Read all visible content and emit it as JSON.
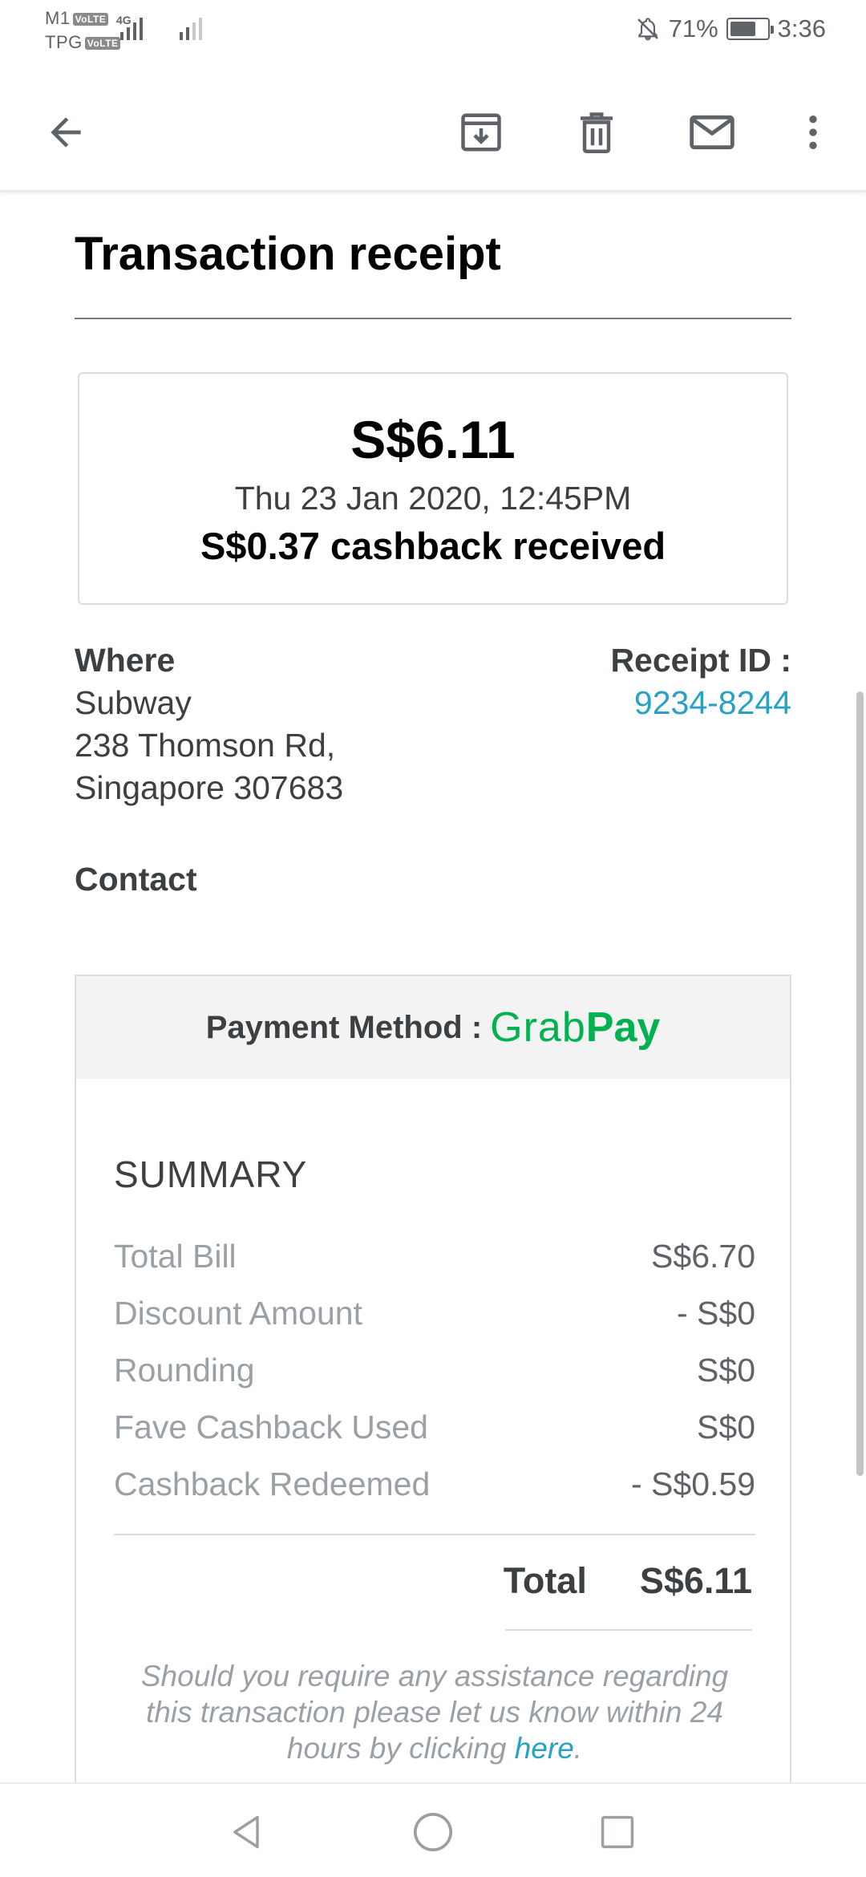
{
  "status_bar": {
    "carrier1": "M1",
    "carrier2": "TPG",
    "volte": "VoLTE",
    "network": "4G",
    "battery": "71%",
    "battery_level": 0.71,
    "time": "3:36",
    "icons": [
      "do-not-disturb-icon",
      "signal-icon",
      "battery-icon"
    ]
  },
  "toolbar": {
    "icons": [
      "back-arrow-icon",
      "archive-icon",
      "delete-icon",
      "mail-icon",
      "more-vert-icon"
    ]
  },
  "receipt": {
    "title": "Transaction receipt",
    "amount": "S$6.11",
    "date": "Thu 23 Jan 2020, 12:45PM",
    "cashback": "S$0.37 cashback received",
    "where_label": "Where",
    "merchant": "Subway",
    "address_line1": "238 Thomson Rd,",
    "address_line2": "Singapore 307683",
    "receipt_id_label": "Receipt ID :",
    "receipt_id": "9234-8244",
    "contact_label": "Contact"
  },
  "payment": {
    "label": "Payment Method :",
    "logo_part1": "Grab",
    "logo_part2": "Pay",
    "brand_color": "#00b14f"
  },
  "summary": {
    "title": "SUMMARY",
    "rows": [
      {
        "label": "Total Bill",
        "value": "S$6.70"
      },
      {
        "label": "Discount Amount",
        "value": "- S$0"
      },
      {
        "label": "Rounding",
        "value": "S$0"
      },
      {
        "label": "Fave Cashback Used",
        "value": "S$0"
      },
      {
        "label": "Cashback Redeemed",
        "value": "- S$0.59"
      }
    ],
    "total_label": "Total",
    "total_value": "S$6.11",
    "assist_text": "Should you require any assistance regarding this transaction please let us know within 24 hours by clicking ",
    "assist_link": "here",
    "assist_end": ".",
    "link_color": "#28a1c5"
  },
  "nav_bar": {
    "icons": [
      "nav-back-icon",
      "nav-home-icon",
      "nav-recent-icon"
    ]
  }
}
